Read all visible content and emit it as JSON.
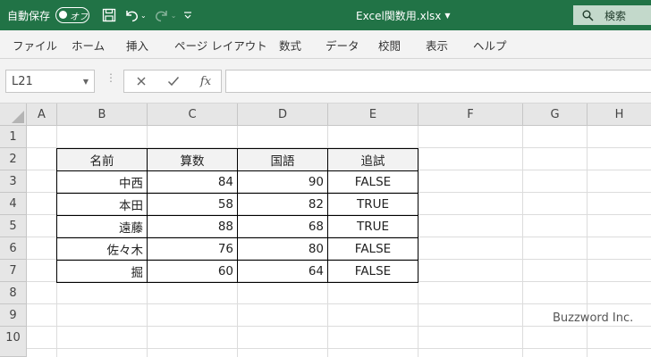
{
  "titlebar": {
    "autosave_label": "自動保存",
    "autosave_state": "オフ",
    "file_name": "Excel関数用.xlsx",
    "search_label": "検索",
    "bg_color": "#217346"
  },
  "ribbon": {
    "tabs": [
      "ファイル",
      "ホーム",
      "挿入",
      "ページ レイアウト",
      "数式",
      "データ",
      "校閲",
      "表示",
      "ヘルプ"
    ]
  },
  "formula_bar": {
    "name_box": "L21",
    "formula": ""
  },
  "grid": {
    "columns": [
      "A",
      "B",
      "C",
      "D",
      "E",
      "F",
      "G",
      "H"
    ],
    "rows": [
      "1",
      "2",
      "3",
      "4",
      "5",
      "6",
      "7",
      "8",
      "9",
      "10"
    ],
    "table": {
      "headers": [
        "名前",
        "算数",
        "国語",
        "追試"
      ],
      "rows": [
        [
          "中西",
          "84",
          "90",
          "FALSE"
        ],
        [
          "本田",
          "58",
          "82",
          "TRUE"
        ],
        [
          "遠藤",
          "88",
          "68",
          "TRUE"
        ],
        [
          "佐々木",
          "76",
          "80",
          "FALSE"
        ],
        [
          "掘",
          "60",
          "64",
          "FALSE"
        ]
      ]
    }
  },
  "watermark": "Buzzword Inc."
}
